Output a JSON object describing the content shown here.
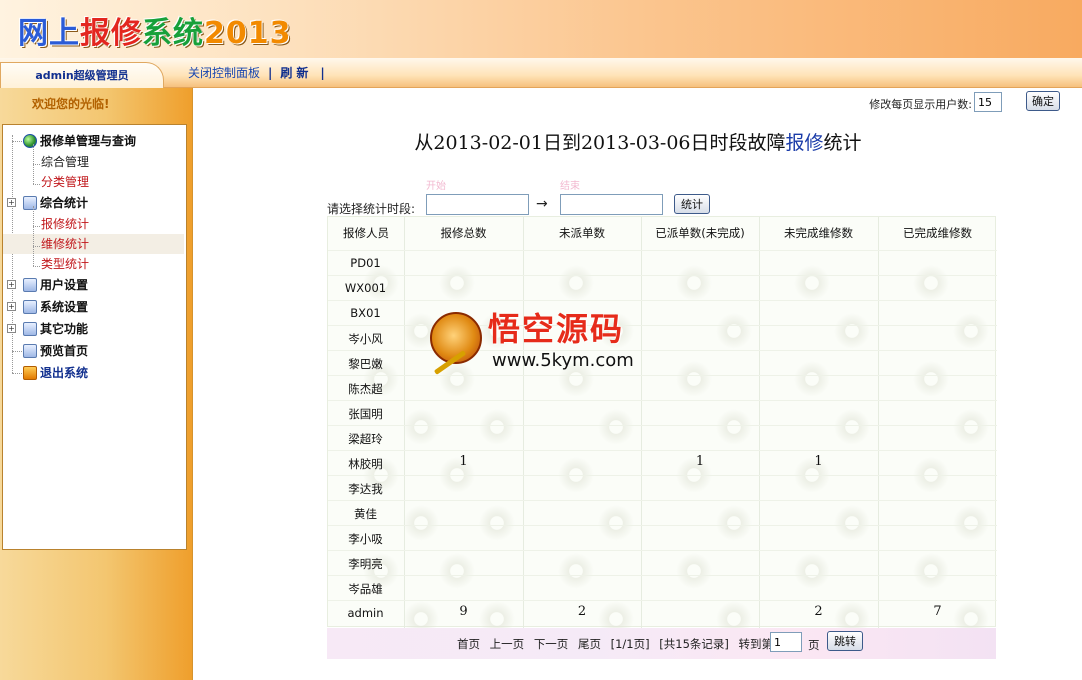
{
  "app": {
    "logo_text": "网上报修系统2013"
  },
  "nav": {
    "user_label": "admin超级管理员",
    "close_panel": "关闭控制面板",
    "separator": "|",
    "refresh": "刷新"
  },
  "sidebar": {
    "welcome": "欢迎您的光临!",
    "tree": [
      {
        "label": "报修单管理与查询",
        "icon": "globe-icon",
        "level": 0
      },
      {
        "label": "综合管理",
        "level": 1,
        "color": "#1d1d1d"
      },
      {
        "label": "分类管理",
        "level": 1,
        "color": "#c0161a"
      },
      {
        "label": "综合统计",
        "icon": "folder-icon",
        "level": 0,
        "expander": "+"
      },
      {
        "label": "报修统计",
        "level": 1,
        "color": "#c0161a"
      },
      {
        "label": "维修统计",
        "level": 1,
        "color": "#c0161a"
      },
      {
        "label": "类型统计",
        "level": 1,
        "color": "#c0161a"
      },
      {
        "label": "用户设置",
        "icon": "folder-icon",
        "level": 0,
        "expander": "+"
      },
      {
        "label": "系统设置",
        "icon": "folder-icon",
        "level": 0,
        "expander": "+"
      },
      {
        "label": "其它功能",
        "icon": "folder-icon",
        "level": 0,
        "expander": "+"
      },
      {
        "label": "预览首页",
        "icon": "page-icon",
        "level": 0
      },
      {
        "label": "退出系统",
        "icon": "exit-icon",
        "level": 0
      }
    ]
  },
  "main": {
    "perpage_label": "修改每页显示用户数:",
    "perpage_value": "15",
    "ok_button": "确定",
    "title_prefix": "从2013-02-01日到2013-03-06日时段故障",
    "title_highlight": "报修",
    "title_suffix": "统计",
    "filter_label": "请选择统计时段:",
    "filter_arrow": "→",
    "stat_button": "统计",
    "ghost_start": "开始",
    "ghost_end": "结束"
  },
  "table": {
    "headers": [
      "报修人员",
      "报修总数",
      "未派单数",
      "已派单数(未完成)",
      "未完成维修数",
      "已完成维修数"
    ],
    "rows": [
      {
        "name": "PD01",
        "values": [
          "",
          "",
          "",
          "",
          ""
        ]
      },
      {
        "name": "WX001",
        "values": [
          "",
          "",
          "",
          "",
          ""
        ]
      },
      {
        "name": "BX01",
        "values": [
          "",
          "",
          "",
          "",
          ""
        ]
      },
      {
        "name": "岑小风",
        "values": [
          "",
          "",
          "",
          "",
          ""
        ]
      },
      {
        "name": "黎巴嫩",
        "values": [
          "",
          "",
          "",
          "",
          ""
        ]
      },
      {
        "name": "陈杰超",
        "values": [
          "",
          "",
          "",
          "",
          ""
        ]
      },
      {
        "name": "张国明",
        "values": [
          "",
          "",
          "",
          "",
          ""
        ]
      },
      {
        "name": "梁超玲",
        "values": [
          "",
          "",
          "",
          "",
          ""
        ]
      },
      {
        "name": "林胶明",
        "values": [
          "1",
          "",
          "1",
          "1",
          ""
        ]
      },
      {
        "name": "李达我",
        "values": [
          "",
          "",
          "",
          "",
          ""
        ]
      },
      {
        "name": "黄佳",
        "values": [
          "",
          "",
          "",
          "",
          ""
        ]
      },
      {
        "name": "李小吸",
        "values": [
          "",
          "",
          "",
          "",
          ""
        ]
      },
      {
        "name": "李明亮",
        "values": [
          "",
          "",
          "",
          "",
          ""
        ]
      },
      {
        "name": "岑品雄",
        "values": [
          "",
          "",
          "",
          "",
          ""
        ]
      },
      {
        "name": "admin",
        "values": [
          "9",
          "2",
          "",
          "2",
          "7"
        ]
      }
    ]
  },
  "pager": {
    "first": "首页",
    "prev": "上一页",
    "next": "下一页",
    "last": "尾页",
    "page_info": "[1/1页]",
    "record_info": "[共15条记录]",
    "goto_label": "转到第",
    "goto_value": "1",
    "page_unit": "页",
    "go_button": "跳转"
  },
  "watermark": {
    "title": "悟空源码",
    "url": "www.5kym.com"
  }
}
